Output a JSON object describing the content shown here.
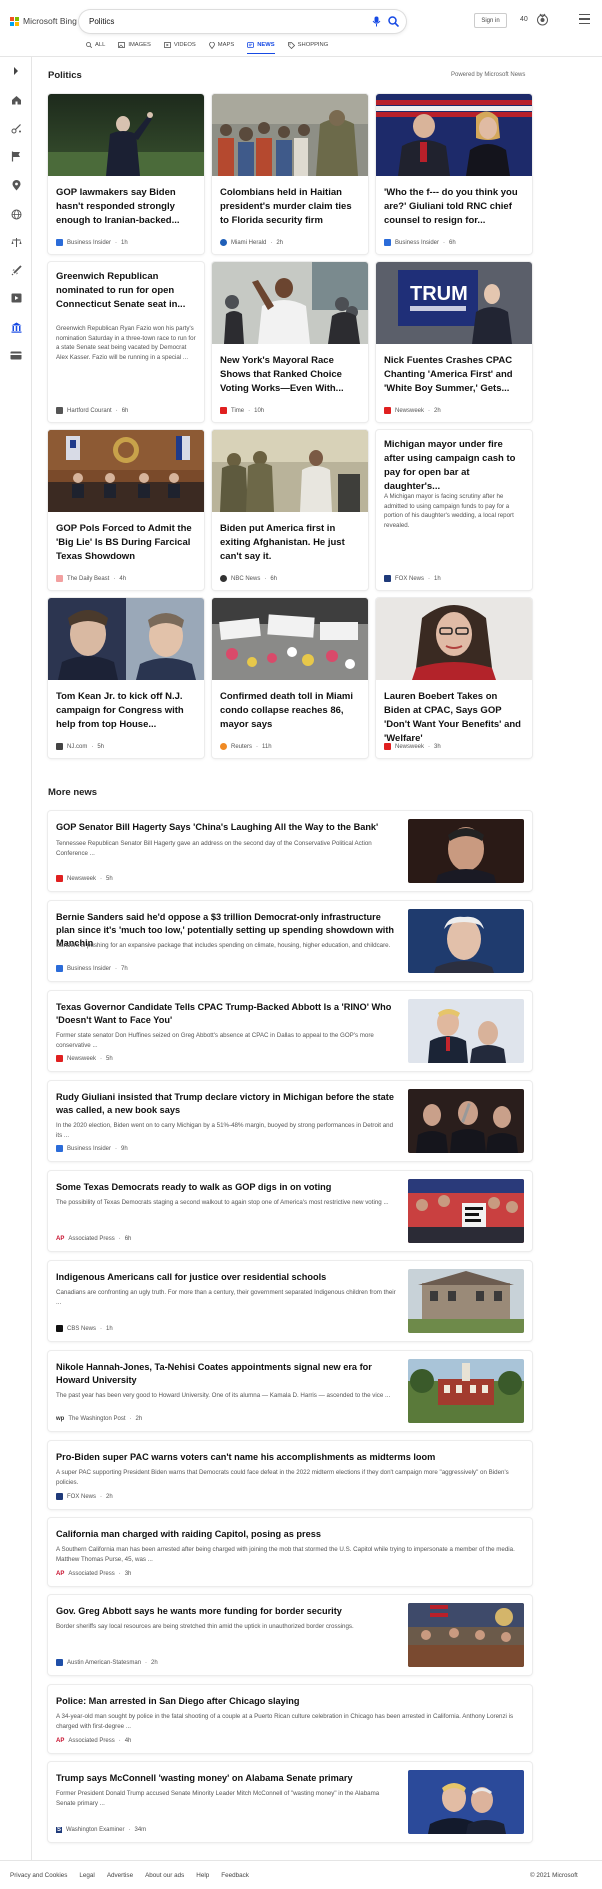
{
  "header": {
    "brand": "Microsoft Bing",
    "search_value": "Politics",
    "signin_label": "Sign in",
    "points": "40",
    "colors": {
      "brand_blue": "#174ae4"
    },
    "tabs": [
      {
        "label": "ALL",
        "icon": "search-icon"
      },
      {
        "label": "IMAGES",
        "icon": "image-icon"
      },
      {
        "label": "VIDEOS",
        "icon": "video-icon"
      },
      {
        "label": "MAPS",
        "icon": "map-pin-icon"
      },
      {
        "label": "NEWS",
        "icon": "news-icon",
        "active": true
      },
      {
        "label": "SHOPPING",
        "icon": "tag-icon"
      }
    ]
  },
  "sidebar": {
    "icons": [
      "chevron-right-icon",
      "home-icon",
      "science-icon",
      "flag-icon",
      "location-pin-icon",
      "globe-icon",
      "scales-icon",
      "rocket-icon",
      "video-icon",
      "bank-icon",
      "money-icon"
    ]
  },
  "politics": {
    "title": "Politics",
    "powered_by": "Powered by Microsoft News",
    "cards": [
      {
        "title": "GOP lawmakers say Biden hasn't responded strongly enough to Iranian-backed...",
        "desc": "",
        "source": "Business Insider",
        "time": "1h",
        "source_color": "#2b6cd9",
        "image": "biden-walking"
      },
      {
        "title": "Colombians held in Haitian president's murder claim ties to Florida security firm",
        "desc": "",
        "source": "Miami Herald",
        "time": "2h",
        "source_color": "#1f5fb8",
        "image": "crowd-soldier"
      },
      {
        "title": "'Who the f--- do you think you are?' Giuliani told RNC chief counsel to resign for...",
        "desc": "",
        "source": "Business Insider",
        "time": "6h",
        "source_color": "#2b6cd9",
        "image": "giuliani-flags"
      },
      {
        "title": "Greenwich Republican nominated to run for open Connecticut Senate seat in...",
        "desc": "Greenwich Republican Ryan Fazio won his party's nomination Saturday in a three-town race to run for a state Senate seat being vacated by Democrat Alex Kasser. Fazio will be running in a special ...",
        "source": "Hartford Courant",
        "time": "6h",
        "source_color": "#555555",
        "image": ""
      },
      {
        "title": "New York's Mayoral Race Shows that Ranked Choice Voting Works—Even With...",
        "desc": "",
        "source": "Time",
        "time": "10h",
        "source_color": "#e02020",
        "image": "mayor-crowd"
      },
      {
        "title": "Nick Fuentes Crashes CPAC Chanting 'America First' and 'White Boy Summer,' Gets...",
        "desc": "",
        "source": "Newsweek",
        "time": "2h",
        "source_color": "#e02020",
        "image": "trump-sign"
      },
      {
        "title": "GOP Pols Forced to Admit the 'Big Lie' Is BS During Farcical Texas Showdown",
        "desc": "",
        "source": "The Daily Beast",
        "time": "4h",
        "source_color": "#f2a0a0",
        "image": "texas-hearing"
      },
      {
        "title": "Biden put America first in exiting Afghanistan. He just can't say it.",
        "desc": "",
        "source": "NBC News",
        "time": "6h",
        "source_color": "#333333",
        "image": "afghan-soldiers"
      },
      {
        "title": "Michigan mayor under fire after using campaign cash to pay for open bar at daughter's...",
        "desc": "A Michigan mayor is facing scrutiny after he admitted to using campaign funds to pay for a portion of his daughter's wedding, a local report revealed.",
        "source": "FOX News",
        "time": "1h",
        "source_color": "#1f3a7a",
        "image": ""
      },
      {
        "title": "Tom Kean Jr. to kick off N.J. campaign for Congress with help from top House...",
        "desc": "",
        "source": "NJ.com",
        "time": "5h",
        "source_color": "#444444",
        "image": "two-men"
      },
      {
        "title": "Confirmed death toll in Miami condo collapse reaches 86, mayor says",
        "desc": "",
        "source": "Reuters",
        "time": "11h",
        "source_color": "#f08a24",
        "image": "memorial"
      },
      {
        "title": "Lauren Boebert Takes on Biden at CPAC, Says GOP 'Don't Want Your Benefits' and 'Welfare'",
        "desc": "",
        "source": "Newsweek",
        "time": "3h",
        "source_color": "#e02020",
        "image": "boebert"
      }
    ]
  },
  "more_news": {
    "title": "More news",
    "items": [
      {
        "title": "GOP Senator Bill Hagerty Says 'China's Laughing All the Way to the Bank'",
        "desc": "Tennessee Republican Senator Bill Hagerty gave an address on the second day of the Conservative Political Action Conference ...",
        "source": "Newsweek",
        "time": "5h",
        "source_color": "#e02020",
        "image": "hagerty"
      },
      {
        "title": "Bernie Sanders said he'd oppose a $3 trillion Democrat-only infrastructure plan since it's 'much too low,' potentially setting up spending showdown with Manchin",
        "desc": "Sanders is pushing for an expansive package that includes spending on climate, housing, higher education, and childcare.",
        "source": "Business Insider",
        "time": "7h",
        "source_color": "#2b6cd9",
        "image": "sanders"
      },
      {
        "title": "Texas Governor Candidate Tells CPAC Trump-Backed Abbott Is a 'RINO' Who 'Doesn't Want to Face You'",
        "desc": "Former state senator Don Huffines seized on Greg Abbott's absence at CPAC in Dallas to appeal to the GOP's more conservative ...",
        "source": "Newsweek",
        "time": "5h",
        "source_color": "#e02020",
        "image": "trump-abbott"
      },
      {
        "title": "Rudy Giuliani insisted that Trump declare victory in Michigan before the state was called, a new book says",
        "desc": "In the 2020 election, Biden went on to carry Michigan by a 51%-48% margin, buoyed by strong performances in Detroit and its ...",
        "source": "Business Insider",
        "time": "9h",
        "source_color": "#2b6cd9",
        "image": "giuliani-crowd"
      },
      {
        "title": "Some Texas Democrats ready to walk as GOP digs in on voting",
        "desc": "The possibility of Texas Democrats staging a second walkout to again stop one of America's most restrictive new voting ...",
        "source": "Associated Press",
        "time": "6h",
        "source_color": "#c8102e",
        "image": "texas-rally"
      },
      {
        "title": "Indigenous Americans call for justice over residential schools",
        "desc": "Canadians are confronting an ugly truth. For more than a century, their government separated Indigenous children from their ...",
        "source": "CBS News",
        "time": "1h",
        "source_color": "#111111",
        "image": "school-building"
      },
      {
        "title": "Nikole Hannah-Jones, Ta-Nehisi Coates appointments signal new era for Howard University",
        "desc": "The past year has been very good to Howard University. One of its alumna — Kamala D. Harris — ascended to the vice ...",
        "source": "The Washington Post",
        "time": "2h",
        "source_color": "#333333",
        "image": "howard-campus"
      },
      {
        "title": "Pro-Biden super PAC warns voters can't name his accomplishments as midterms loom",
        "desc": "A super PAC supporting President Biden warns that Democrats could face defeat in the 2022 midterm elections if they don't campaign more \"aggressively\" on Biden's policies.",
        "source": "FOX News",
        "time": "2h",
        "source_color": "#1f3a7a",
        "image": ""
      },
      {
        "title": "California man charged with raiding Capitol, posing as press",
        "desc": "A Southern California man has been arrested after being charged with joining the mob that stormed the U.S. Capitol while trying to impersonate a member of the media. Matthew Thomas Purse, 45, was ...",
        "source": "Associated Press",
        "time": "3h",
        "source_color": "#c8102e",
        "image": ""
      },
      {
        "title": "Gov. Greg Abbott says he wants more funding for border security",
        "desc": "Border sheriffs say local resources are being stretched thin amid the uptick in unauthorized border crossings.",
        "source": "Austin American-Statesman",
        "time": "2h",
        "source_color": "#1f4fa8",
        "image": "abbott-table"
      },
      {
        "title": "Police: Man arrested in San Diego after Chicago slaying",
        "desc": "A 34-year-old man sought by police in the fatal shooting of a couple at a Puerto Rican culture celebration in Chicago has been arrested in California. Anthony Lorenzi is charged with first-degree ...",
        "source": "Associated Press",
        "time": "4h",
        "source_color": "#c8102e",
        "image": ""
      },
      {
        "title": "Trump says McConnell 'wasting money' on Alabama Senate primary",
        "desc": "Former President Donald Trump accused Senate Minority Leader Mitch McConnell of \"wasting money\" in the Alabama Senate primary ...",
        "source": "Washington Examiner",
        "time": "34m",
        "source_color": "#1f3a7a",
        "image": "trump-mcconnell"
      }
    ]
  },
  "footer": {
    "links": [
      "Privacy and Cookies",
      "Legal",
      "Advertise",
      "About our ads",
      "Help",
      "Feedback"
    ],
    "copyright": "© 2021 Microsoft"
  }
}
